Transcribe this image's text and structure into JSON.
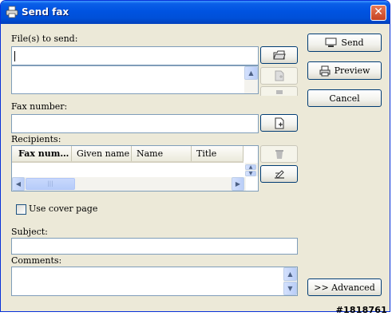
{
  "window": {
    "title": "Send fax"
  },
  "files": {
    "label": "File(s) to send:",
    "value": ""
  },
  "fax_number": {
    "label": "Fax number:",
    "value": ""
  },
  "recipients": {
    "label": "Recipients:",
    "columns": [
      "Fax num…",
      "Given name",
      "Name",
      "Title"
    ]
  },
  "cover_page": {
    "label": "Use cover page",
    "checked": false
  },
  "subject": {
    "label": "Subject:",
    "value": ""
  },
  "comments": {
    "label": "Comments:",
    "value": ""
  },
  "buttons": {
    "send": "Send",
    "preview": "Preview",
    "cancel": "Cancel",
    "advanced": ">> Advanced"
  },
  "icons": {
    "title": "printer-icon",
    "browse": "folder-open-icon",
    "add_file": "add-document-icon",
    "delete_file": "delete-icon",
    "address_book": "address-book-icon",
    "delete_recipient": "trash-icon",
    "edit_recipient": "edit-icon",
    "send": "monitor-icon",
    "preview": "printer-icon"
  },
  "watermark": "#1818761"
}
